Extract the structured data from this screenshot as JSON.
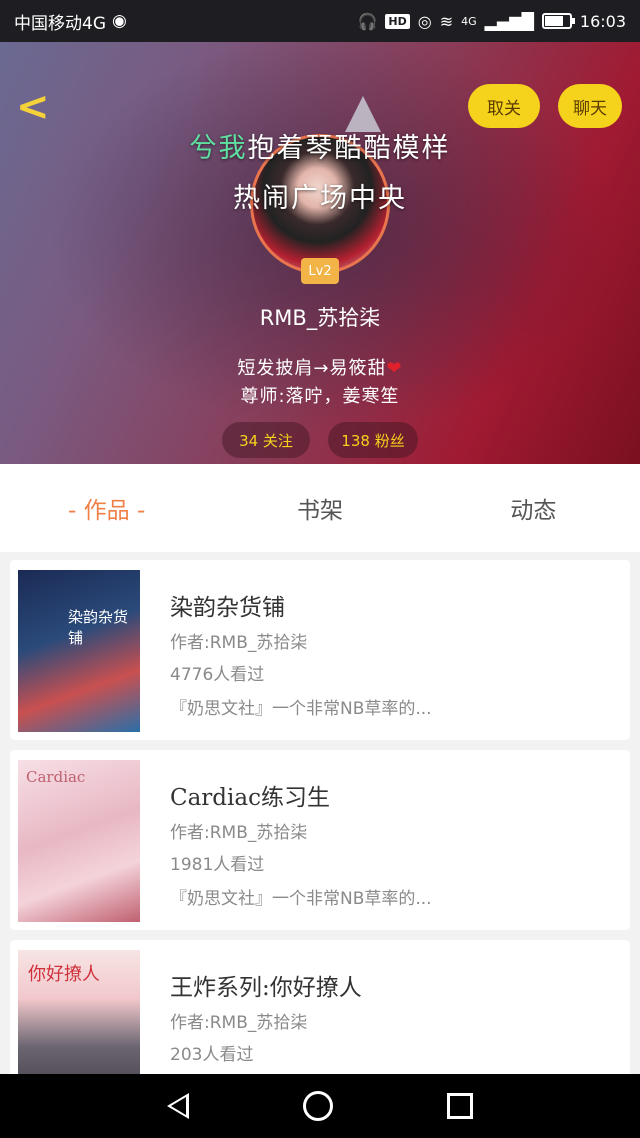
{
  "status_bar": {
    "carrier": "中国移动4G",
    "hd": "HD",
    "network": "4G",
    "battery_level": 0.7,
    "time": "16:03"
  },
  "header": {
    "back_icon": "chevron-left-icon",
    "unfollow_label": "取关",
    "chat_label": "聊天",
    "signature_line1_highlight": "兮我",
    "signature_line1_rest": "抱着琴酷酷模样",
    "signature_line2": "热闹广场中央",
    "level": "Lv2",
    "username": "RMB_苏拾柒",
    "bio_line1": "短发披肩→易筱甜",
    "bio_line2": "尊师:落咛，姜寒笙",
    "following": "34 关注",
    "fans": "138 粉丝"
  },
  "tabs": [
    {
      "label": "- 作品 -",
      "active": true
    },
    {
      "label": "书架",
      "active": false
    },
    {
      "label": "动态",
      "active": false
    }
  ],
  "works": [
    {
      "cover_text": "染韵杂货铺",
      "title": "染韵杂货铺",
      "author": "作者:RMB_苏拾柒",
      "views": "4776人看过",
      "desc": "『奶思文社』一个非常NB草率的..."
    },
    {
      "cover_text": "Cardiac",
      "title": "Cardiac练习生",
      "author": "作者:RMB_苏拾柒",
      "views": "1981人看过",
      "desc": "『奶思文社』一个非常NB草率的..."
    },
    {
      "cover_text": "你好撩人",
      "title": "王炸系列:你好撩人",
      "author": "作者:RMB_苏拾柒",
      "views": "203人看过",
      "desc": ""
    }
  ],
  "colors": {
    "accent": "#f5d21c",
    "tab_active": "#ef8048",
    "highlight": "#5fe0a0"
  }
}
